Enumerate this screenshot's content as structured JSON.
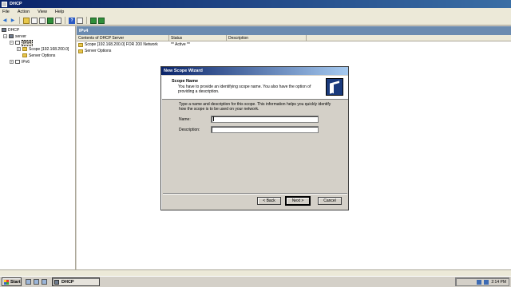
{
  "window": {
    "title": "DHCP"
  },
  "menu": [
    "File",
    "Action",
    "View",
    "Help"
  ],
  "toolbar": {
    "icons": [
      "back-arrow-icon",
      "forward-arrow-icon",
      "up-folder-icon",
      "show-tree-icon",
      "properties-icon",
      "refresh-icon",
      "export-icon",
      "help-icon",
      "console-icon",
      "monitor-icon",
      "screen-icon"
    ]
  },
  "tree": {
    "root": "DHCP",
    "server": "server",
    "ipv4": "IPv4",
    "scope": "Scope [192.168.200.0]",
    "server_options": "Server Options",
    "ipv6": "IPv6"
  },
  "right_pane": {
    "header": "IPv4",
    "columns": [
      "Contents of DHCP Server",
      "Status",
      "Description"
    ],
    "rows": [
      {
        "name": "Scope [192.168.200.0] FOR 200 Network",
        "status": "** Active **",
        "description": ""
      },
      {
        "name": "Server Options",
        "status": "",
        "description": ""
      }
    ]
  },
  "dialog": {
    "title": "New Scope Wizard",
    "heading": "Scope Name",
    "subheading": "You have to provide an identifying scope name. You also have the option of providing a description.",
    "body": "Type a name and description for this scope. This information helps you quickly identify how the scope is to be used on your network.",
    "name_label": "Name:",
    "name_value": "",
    "description_label": "Description:",
    "description_value": "",
    "back_label": "< Back",
    "next_label": "Next >",
    "cancel_label": "Cancel"
  },
  "taskbar": {
    "start": "Start",
    "task": "DHCP",
    "clock": "2:14 PM"
  }
}
